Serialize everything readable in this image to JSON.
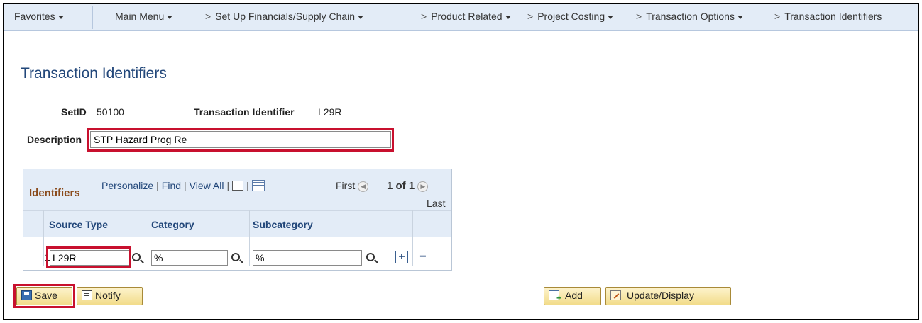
{
  "nav": {
    "favorites": "Favorites",
    "items": [
      {
        "label": "Main Menu",
        "chevron": "",
        "caret": true
      },
      {
        "label": "Set Up Financials/Supply Chain",
        "chevron": ">",
        "caret": true
      },
      {
        "label": "Product Related",
        "chevron": ">",
        "caret": true
      },
      {
        "label": "Project Costing",
        "chevron": ">",
        "caret": true
      },
      {
        "label": "Transaction Options",
        "chevron": ">",
        "caret": true
      },
      {
        "label": "Transaction Identifiers",
        "chevron": ">",
        "caret": false
      }
    ]
  },
  "page": {
    "title": "Transaction Identifiers",
    "setid_label": "SetID",
    "setid_value": "50100",
    "txn_label": "Transaction Identifier",
    "txn_value": "L29R",
    "desc_label": "Description",
    "desc_value": "STP Hazard Prog Re"
  },
  "grid": {
    "title": "Identifiers",
    "personalize": "Personalize",
    "find": "Find",
    "view_all": "View All",
    "first": "First",
    "count": "1 of 1",
    "last": "Last",
    "columns": [
      "Source Type",
      "Category",
      "Subcategory"
    ],
    "row": {
      "num": "1",
      "source_type": "L29R",
      "category": "%",
      "subcategory": "%"
    }
  },
  "buttons": {
    "save": "Save",
    "notify": "Notify",
    "add": "Add",
    "update": "Update/Display"
  },
  "colors": {
    "highlight": "#c8102e",
    "title_blue": "#22477a",
    "nav_bg": "#e3ecf7"
  }
}
